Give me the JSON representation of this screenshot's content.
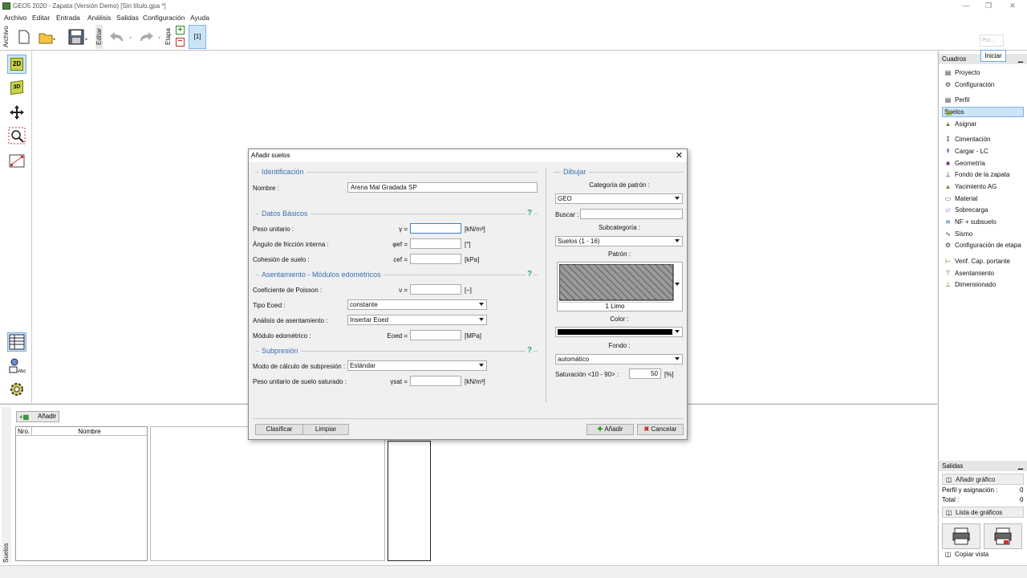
{
  "window": {
    "title": "GEO5 2020 - Zapata (Versión Demo) [Sin título.gpa *]"
  },
  "menu": [
    "Archivo",
    "Editar",
    "Entrada",
    "Análisis",
    "Salidas",
    "Configuración",
    "Ayuda"
  ],
  "toolbar": {
    "archivo": "Archivo",
    "editar": "Editar",
    "etapa": "Etapa",
    "stage_num": "[1]"
  },
  "left_tools": {
    "mode_2d": "2D",
    "mode_3d": "3D"
  },
  "top_right": {
    "small_box": "Poi...",
    "start_button": "Iniciar"
  },
  "right_panel": {
    "header": "Cuadros",
    "items": [
      {
        "label": "Proyecto",
        "icon": "document-icon"
      },
      {
        "label": "Configuración",
        "icon": "gear-icon"
      },
      {
        "label": "Perfil",
        "icon": "profile-icon"
      },
      {
        "label": "Suelos",
        "icon": "soil-icon",
        "selected": true
      },
      {
        "label": "Asignar",
        "icon": "assign-icon"
      },
      {
        "label": "Cimentación",
        "icon": "foundation-icon"
      },
      {
        "label": "Cargar - LC",
        "icon": "load-icon"
      },
      {
        "label": "Geometría",
        "icon": "geometry-icon"
      },
      {
        "label": "Fondo de la zapata",
        "icon": "footing-bottom-icon"
      },
      {
        "label": "Yacimiento AG",
        "icon": "deposit-icon"
      },
      {
        "label": "Material",
        "icon": "material-icon"
      },
      {
        "label": "Sobrecarga",
        "icon": "surcharge-icon"
      },
      {
        "label": "NF + subsuelo",
        "icon": "water-table-icon"
      },
      {
        "label": "Sismo",
        "icon": "earthquake-icon"
      },
      {
        "label": "Configuración de etapa",
        "icon": "stage-settings-icon"
      },
      {
        "label": "Verif. Cap. portante",
        "icon": "bearing-check-icon"
      },
      {
        "label": "Asentamiento",
        "icon": "settlement-icon"
      },
      {
        "label": "Dimensionado",
        "icon": "dimensioning-icon"
      }
    ],
    "salidas": {
      "header": "Salidas",
      "add_graphic": "Añadir gráfico",
      "perfil_label": "Perfil y asignación :",
      "perfil_value": "0",
      "total_label": "Total :",
      "total_value": "0",
      "list_graphics": "Lista de gráficos",
      "copy_view": "Copiar vista"
    }
  },
  "bottom": {
    "add_button": "Añadir",
    "col_nro": "Nro.",
    "col_nombre": "Nombre",
    "side_label": "Suelos"
  },
  "dialog": {
    "title": "Añadir suelos",
    "identificacion": {
      "header": "Identificación",
      "nombre_label": "Nombre :",
      "nombre_value": "Arena Mal Gradada SP"
    },
    "datos_basicos": {
      "header": "Datos Básicos",
      "peso_label": "Peso unitario :",
      "peso_sym": "γ =",
      "peso_value": "",
      "peso_unit": "[kN/m³]",
      "friccion_label": "Ángulo de fricción interna :",
      "friccion_sym": "φef =",
      "friccion_value": "",
      "friccion_unit": "[°]",
      "cohesion_label": "Cohesión de suelo :",
      "cohesion_sym": "cef =",
      "cohesion_value": "",
      "cohesion_unit": "[kPa]"
    },
    "asentamiento": {
      "header": "Asentamiento - Módulos edométricos",
      "poisson_label": "Coeficiente de Poisson :",
      "poisson_sym": "ν =",
      "poisson_value": "",
      "poisson_unit": "[–]",
      "tipo_label": "Tipo Eoed :",
      "tipo_value": "constante",
      "analisis_label": "Análisis de asentamiento :",
      "analisis_value": "Insertar Eoed",
      "modulo_label": "Módulo edométrico :",
      "modulo_sym": "Eoed =",
      "modulo_value": "",
      "modulo_unit": "[MPa]"
    },
    "subpresion": {
      "header": "Subpresión",
      "modo_label": "Modo de cálculo de subpresión :",
      "modo_value": "Estándar",
      "peso_sat_label": "Peso unitario de suelo saturado :",
      "peso_sat_sym": "γsat =",
      "peso_sat_value": "",
      "peso_sat_unit": "[kN/m³]"
    },
    "dibujar": {
      "header": "Dibujar",
      "categoria_label": "Categoría de patrón :",
      "categoria_value": "GEO",
      "buscar_label": "Buscar :",
      "buscar_value": "",
      "subcategoria_label": "Subcategoría :",
      "subcategoria_value": "Suelos (1 - 16)",
      "patron_label": "Patrón :",
      "patron_name": "1 Limo",
      "color_label": "Color :",
      "color_value": "#000000",
      "fondo_label": "Fondo :",
      "fondo_value": "automático",
      "saturacion_label": "Saturación <10 - 90> :",
      "saturacion_value": "50",
      "saturacion_unit": "[%]"
    },
    "buttons": {
      "clasificar": "Clasificar",
      "limpiar": "Limpiar",
      "anadir": "Añadir",
      "cancelar": "Cancelar"
    }
  }
}
